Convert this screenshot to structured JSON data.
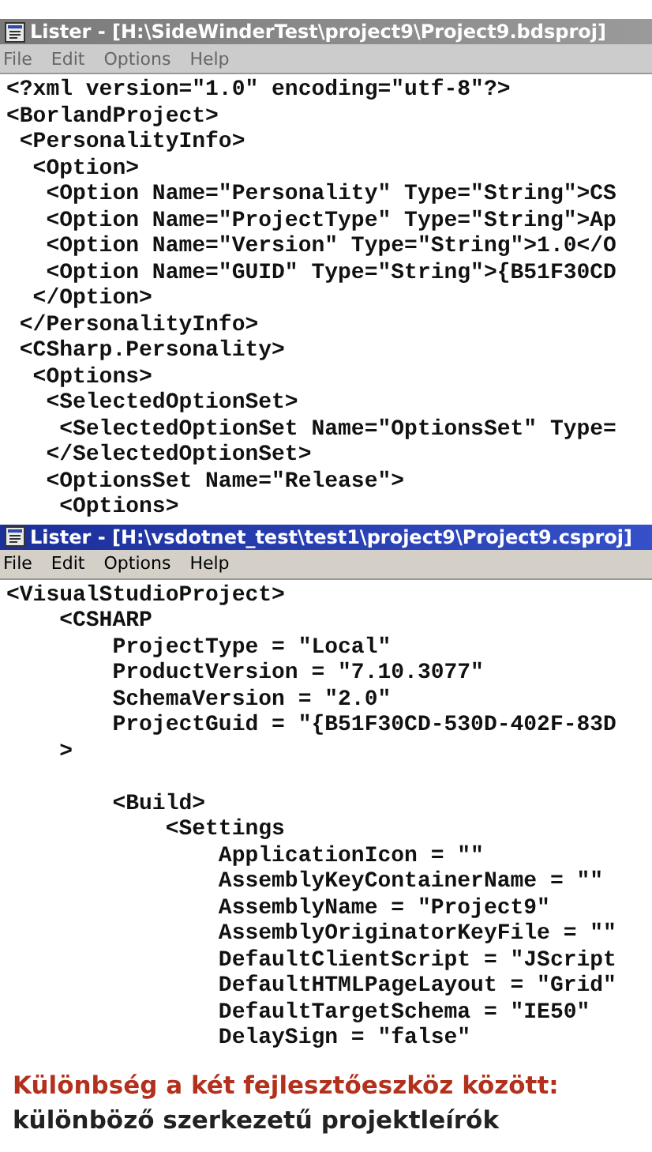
{
  "windows": [
    {
      "title": "Lister - [H:\\SideWinderTest\\project9\\Project9.bdsproj]",
      "active": false,
      "menu": [
        "File",
        "Edit",
        "Options",
        "Help"
      ],
      "blocks": [
        [
          "<?xml version=\"1.0\" encoding=\"utf-8\"?>",
          "<BorlandProject>",
          " <PersonalityInfo>",
          "  <Option>",
          "   <Option Name=\"Personality\" Type=\"String\">CS",
          "   <Option Name=\"ProjectType\" Type=\"String\">Ap",
          "   <Option Name=\"Version\" Type=\"String\">1.0</O",
          "   <Option Name=\"GUID\" Type=\"String\">{B51F30CD",
          "  </Option>",
          " </PersonalityInfo>",
          " <CSharp.Personality>",
          "  <Options>",
          "   <SelectedOptionSet>",
          "    <SelectedOptionSet Name=\"OptionsSet\" Type=",
          "   </SelectedOptionSet>",
          "   <OptionsSet Name=\"Release\">",
          "    <Options>"
        ]
      ]
    },
    {
      "title": "Lister - [H:\\vsdotnet_test\\test1\\project9\\Project9.csproj]",
      "active": true,
      "menu": [
        "File",
        "Edit",
        "Options",
        "Help"
      ],
      "blocks": [
        [
          "<VisualStudioProject>",
          "    <CSHARP",
          "        ProjectType = \"Local\"",
          "        ProductVersion = \"7.10.3077\"",
          "        SchemaVersion = \"2.0\"",
          "        ProjectGuid = \"{B51F30CD-530D-402F-83D",
          "    >"
        ],
        [
          "        <Build>",
          "            <Settings",
          "                ApplicationIcon = \"\"",
          "                AssemblyKeyContainerName = \"\"",
          "                AssemblyName = \"Project9\"",
          "                AssemblyOriginatorKeyFile = \"\"",
          "                DefaultClientScript = \"JScript",
          "                DefaultHTMLPageLayout = \"Grid\"",
          "                DefaultTargetSchema = \"IE50\"",
          "                DelaySign = \"false\""
        ]
      ]
    }
  ],
  "caption": {
    "title": "Különbség a két fejlesztőeszköz között:",
    "subtitle": "különböző szerkezetű projektleírók"
  }
}
